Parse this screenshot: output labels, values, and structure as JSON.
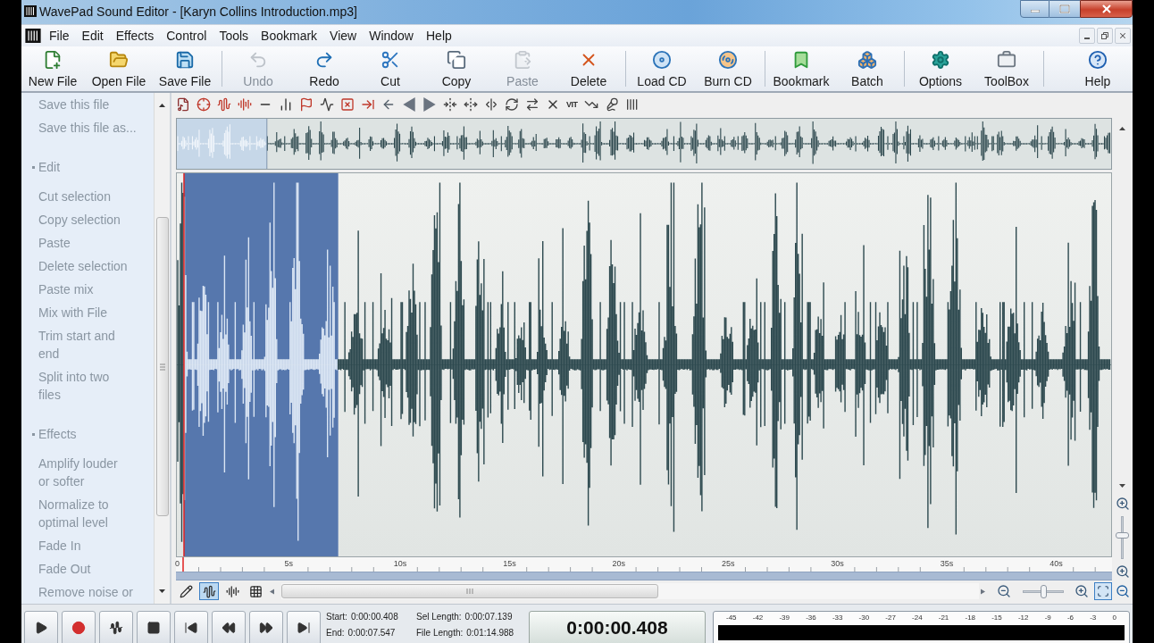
{
  "window": {
    "title": "WavePad Sound Editor - [Karyn Collins Introduction.mp3]"
  },
  "menu": [
    "File",
    "Edit",
    "Effects",
    "Control",
    "Tools",
    "Bookmark",
    "View",
    "Window",
    "Help"
  ],
  "toolbar": [
    [
      {
        "label": "New File",
        "disabled": false
      },
      {
        "label": "Open File",
        "disabled": false
      },
      {
        "label": "Save File",
        "disabled": false
      }
    ],
    [
      {
        "label": "Undo",
        "disabled": true
      },
      {
        "label": "Redo",
        "disabled": false
      },
      {
        "label": "Cut",
        "disabled": false
      },
      {
        "label": "Copy",
        "disabled": false
      },
      {
        "label": "Paste",
        "disabled": true
      },
      {
        "label": "Delete",
        "disabled": false
      }
    ],
    [
      {
        "label": "Load CD",
        "disabled": false
      },
      {
        "label": "Burn CD",
        "disabled": false
      }
    ],
    [
      {
        "label": "Bookmark",
        "disabled": false
      },
      {
        "label": "Batch",
        "disabled": false
      }
    ],
    [
      {
        "label": "Options",
        "disabled": false
      },
      {
        "label": "ToolBox",
        "disabled": false
      }
    ],
    [
      {
        "label": "Help",
        "disabled": false
      }
    ]
  ],
  "sidebar": {
    "sections": [
      {
        "items": [
          "Save this file",
          "Save this file as..."
        ]
      },
      {
        "title": "Edit",
        "items": [
          "Cut selection",
          "Copy selection",
          "Paste",
          "Delete selection",
          "Paste mix",
          "Mix with File",
          "Trim start and\nend",
          "Split into two\nfiles"
        ]
      },
      {
        "title": "Effects",
        "items": [
          "Amplify louder\nor softer",
          "Normalize to\noptimal level",
          "Fade In",
          "Fade Out",
          "Remove noise or"
        ]
      }
    ]
  },
  "edit_tools": {
    "text_button": "VIT"
  },
  "timeline": {
    "labels": [
      "0",
      "5s",
      "10s",
      "15s",
      "20s",
      "25s",
      "30s",
      "35s",
      "40s"
    ]
  },
  "view_modes": [
    {
      "kind": "pencil",
      "selected": false
    },
    {
      "kind": "waveform",
      "selected": true
    },
    {
      "kind": "waveform_arrows",
      "selected": false
    },
    {
      "kind": "spectral",
      "selected": false
    }
  ],
  "horizontal_zoom": {
    "level": 0.5
  },
  "vertical_zoom": {
    "level": 0.55
  },
  "selection_info": [
    {
      "label": "Start:",
      "value": "0:00:00.408"
    },
    {
      "label": "Sel Length:",
      "value": "0:00:07.139"
    },
    {
      "label": "End:",
      "value": "0:00:07.547"
    },
    {
      "label": "File Length:",
      "value": "0:01:14.988"
    }
  ],
  "time_display": "0:00:00.408",
  "level_meter": {
    "scale": [
      "-45",
      "-42",
      "-39",
      "-36",
      "-33",
      "-30",
      "-27",
      "-24",
      "-21",
      "-18",
      "-15",
      "-12",
      "-9",
      "-6",
      "-3",
      "0"
    ]
  }
}
